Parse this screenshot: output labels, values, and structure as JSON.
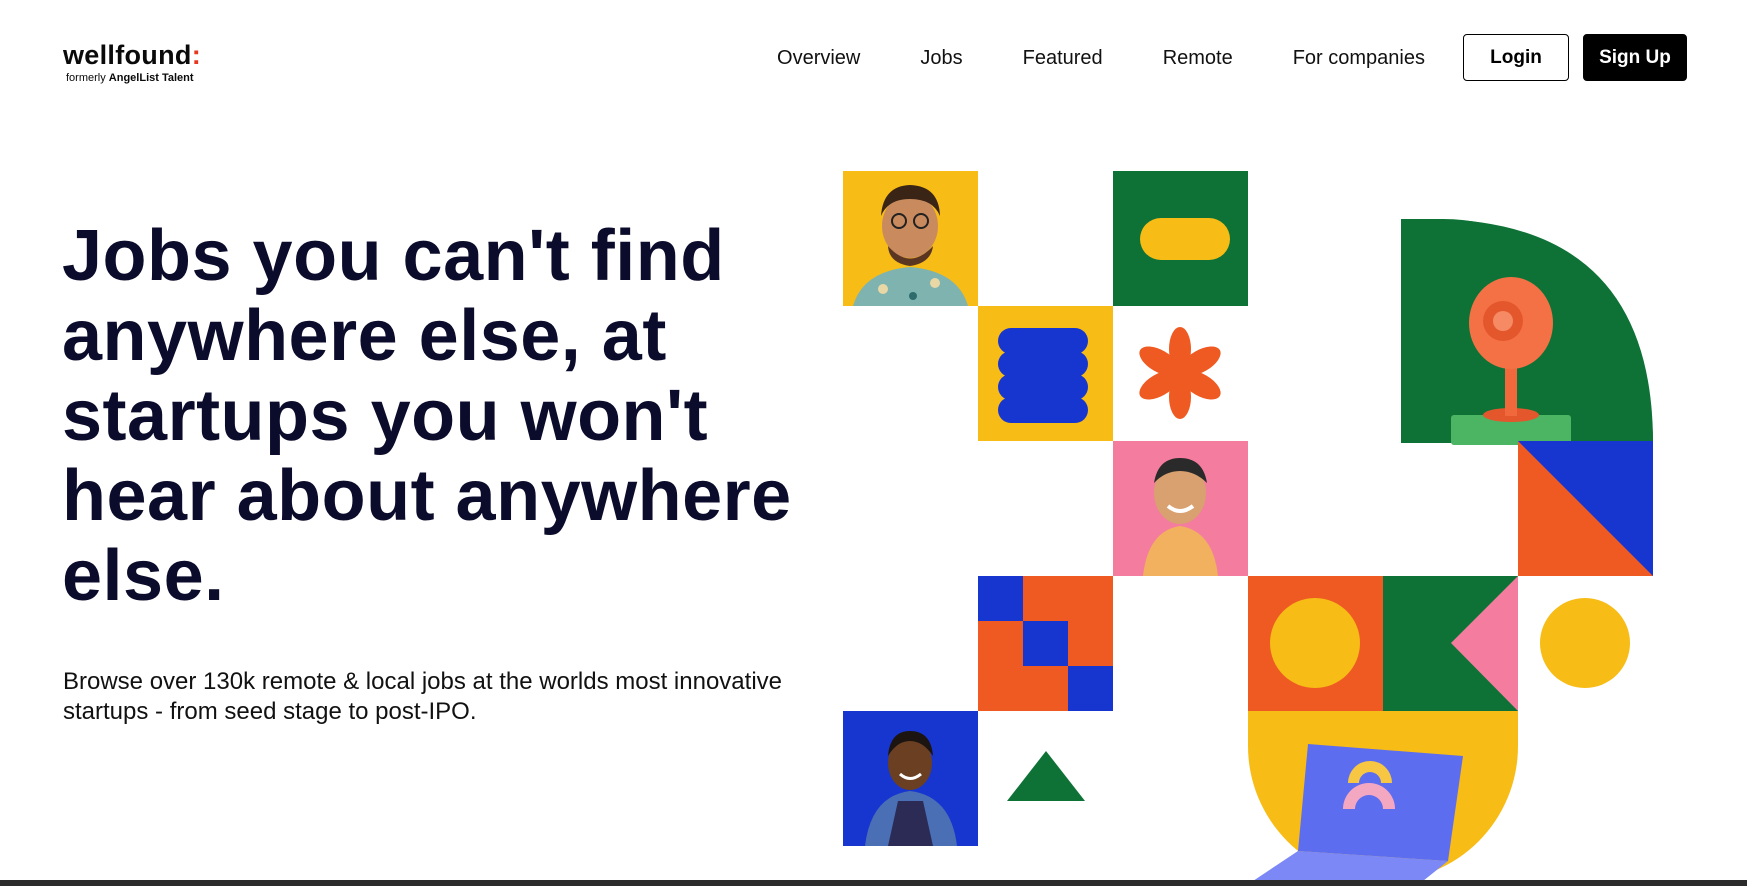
{
  "logo": {
    "name": "wellfound",
    "colon": ":",
    "sub_prefix": "formerly",
    "sub_brand": "AngelList Talent"
  },
  "nav": {
    "links": [
      "Overview",
      "Jobs",
      "Featured",
      "Remote",
      "For companies"
    ],
    "login_label": "Login",
    "signup_label": "Sign Up"
  },
  "hero": {
    "title": "Jobs you can't find anywhere else, at startups you won't hear about anywhere else.",
    "subtitle": "Browse over 130k remote & local jobs at the worlds most innovative startups - from seed stage to post-IPO."
  },
  "colors": {
    "yellow": "#f7bc16",
    "green": "#0e7236",
    "blue": "#1736cf",
    "orange": "#ef5a22",
    "pink": "#f47c9f",
    "accent_red": "#e8361f"
  },
  "illustration": {
    "icons": [
      "person-photo-1",
      "pill-shape",
      "blob-stack",
      "asterisk-shape",
      "person-photo-2",
      "webcam-3d",
      "triangle-split",
      "checker-pattern",
      "circle-on-orange",
      "arrow-shape",
      "yellow-circle",
      "person-photo-3",
      "green-triangle",
      "laptop-3d"
    ]
  }
}
